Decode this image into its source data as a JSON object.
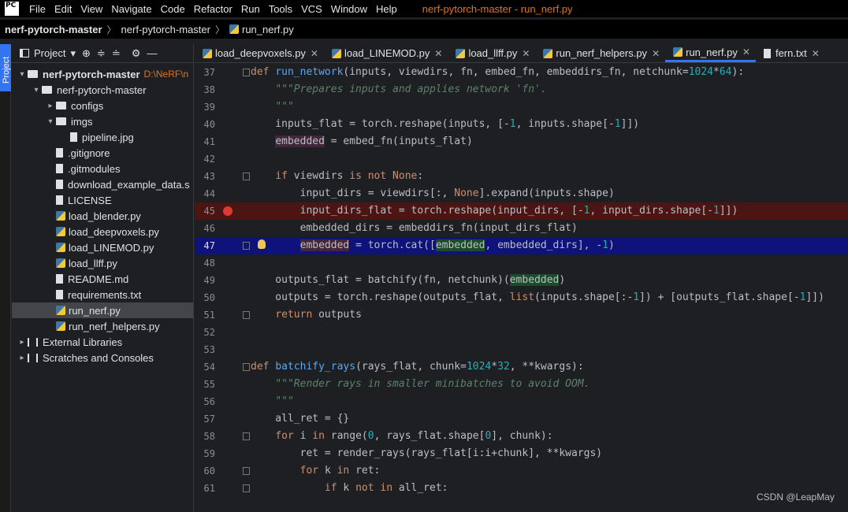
{
  "menubar": {
    "items": [
      "File",
      "Edit",
      "View",
      "Navigate",
      "Code",
      "Refactor",
      "Run",
      "Tools",
      "VCS",
      "Window",
      "Help"
    ],
    "title": "nerf-pytorch-master - run_nerf.py"
  },
  "breadcrumb": {
    "project": "nerf-pytorch-master",
    "folder": "nerf-pytorch-master",
    "file": "run_nerf.py"
  },
  "stripe": {
    "label": "Project"
  },
  "project_panel": {
    "title": "Project",
    "root": "nerf-pytorch-master",
    "root_path": "D:\\NeRF\\n",
    "tree": [
      {
        "label": "nerf-pytorch-master",
        "indent": 1,
        "kind": "folder",
        "arrow": "▾"
      },
      {
        "label": "configs",
        "indent": 2,
        "kind": "folder",
        "arrow": "▸"
      },
      {
        "label": "imgs",
        "indent": 2,
        "kind": "folder",
        "arrow": "▾"
      },
      {
        "label": "pipeline.jpg",
        "indent": 3,
        "kind": "file",
        "arrow": ""
      },
      {
        "label": ".gitignore",
        "indent": 2,
        "kind": "file",
        "arrow": ""
      },
      {
        "label": ".gitmodules",
        "indent": 2,
        "kind": "file",
        "arrow": ""
      },
      {
        "label": "download_example_data.s",
        "indent": 2,
        "kind": "file",
        "arrow": ""
      },
      {
        "label": "LICENSE",
        "indent": 2,
        "kind": "file",
        "arrow": ""
      },
      {
        "label": "load_blender.py",
        "indent": 2,
        "kind": "file",
        "arrow": ""
      },
      {
        "label": "load_deepvoxels.py",
        "indent": 2,
        "kind": "file",
        "arrow": ""
      },
      {
        "label": "load_LINEMOD.py",
        "indent": 2,
        "kind": "file",
        "arrow": ""
      },
      {
        "label": "load_llff.py",
        "indent": 2,
        "kind": "file",
        "arrow": ""
      },
      {
        "label": "README.md",
        "indent": 2,
        "kind": "file",
        "arrow": ""
      },
      {
        "label": "requirements.txt",
        "indent": 2,
        "kind": "file",
        "arrow": ""
      },
      {
        "label": "run_nerf.py",
        "indent": 2,
        "kind": "file",
        "arrow": "",
        "selected": true
      },
      {
        "label": "run_nerf_helpers.py",
        "indent": 2,
        "kind": "file",
        "arrow": ""
      },
      {
        "label": "External Libraries",
        "indent": 0,
        "kind": "lib",
        "arrow": "▸"
      },
      {
        "label": "Scratches and Consoles",
        "indent": 0,
        "kind": "lib",
        "arrow": "▸"
      }
    ]
  },
  "tabs": [
    {
      "label": "load_deepvoxels.py"
    },
    {
      "label": "load_LINEMOD.py"
    },
    {
      "label": "load_llff.py"
    },
    {
      "label": "run_nerf_helpers.py"
    },
    {
      "label": "run_nerf.py",
      "active": true
    },
    {
      "label": "fern.txt"
    }
  ],
  "editor": {
    "lines": [
      {
        "n": "37",
        "html": "<span class='kw'>def </span><span class='fn'>run_network</span>(inputs, viewdirs, fn, embed_fn, embeddirs_fn, netchunk=<span class='num'>1024</span>*<span class='num'>64</span>):",
        "fold": true
      },
      {
        "n": "38",
        "html": "    <span class='doc'>\"\"\"Prepares inputs and applies network 'fn'.</span>"
      },
      {
        "n": "39",
        "html": "    <span class='doc'>\"\"\"</span>"
      },
      {
        "n": "40",
        "html": "    inputs_flat = torch.reshape(inputs, [-<span class='num'>1</span>, inputs.shape[-<span class='num'>1</span>]])"
      },
      {
        "n": "41",
        "html": "    <span class='hl-purple'>embedded</span> = embed_fn(inputs_flat)"
      },
      {
        "n": "42",
        "html": ""
      },
      {
        "n": "43",
        "html": "    <span class='kw'>if </span>viewdirs <span class='kw'>is not None</span>:",
        "fold": true
      },
      {
        "n": "44",
        "html": "        input_dirs = viewdirs[:, <span class='kw'>None</span>].expand(inputs.shape)"
      },
      {
        "n": "45",
        "html": "        input_dirs_flat = torch.reshape(input_dirs, [-<span class='num'>1</span>, input_dirs.shape[-<span class='num'>1</span>]])",
        "bp": true
      },
      {
        "n": "46",
        "html": "        embedded_dirs = embeddirs_fn(input_dirs_flat)"
      },
      {
        "n": "47",
        "html": "        <span class='hl-purple'>embedded</span> = torch.cat([<span class='hl-green'>embedded</span>, embedded_dirs], -<span class='num'>1</span>)",
        "cur": true,
        "fold": true
      },
      {
        "n": "48",
        "html": ""
      },
      {
        "n": "49",
        "html": "    outputs_flat = batchify(fn, netchunk)(<span class='hl-green'>embedded</span>)"
      },
      {
        "n": "50",
        "html": "    outputs = torch.reshape(outputs_flat, <span class='kw'>list</span>(inputs.shape[:-<span class='num'>1</span>]) + [outputs_flat.shape[-<span class='num'>1</span>]])"
      },
      {
        "n": "51",
        "html": "    <span class='kw'>return </span>outputs",
        "fold": true
      },
      {
        "n": "52",
        "html": ""
      },
      {
        "n": "53",
        "html": ""
      },
      {
        "n": "54",
        "html": "<span class='kw'>def </span><span class='fn'>batchify_rays</span>(rays_flat, chunk=<span class='num'>1024</span>*<span class='num'>32</span>, **kwargs):",
        "fold": true
      },
      {
        "n": "55",
        "html": "    <span class='doc'>\"\"\"Render rays in smaller minibatches to avoid OOM.</span>"
      },
      {
        "n": "56",
        "html": "    <span class='doc'>\"\"\"</span>"
      },
      {
        "n": "57",
        "html": "    all_ret = {}"
      },
      {
        "n": "58",
        "html": "    <span class='kw'>for </span>i <span class='kw'>in </span>range(<span class='num'>0</span>, rays_flat.shape[<span class='num'>0</span>], chunk):",
        "fold": true
      },
      {
        "n": "59",
        "html": "        ret = render_rays(rays_flat[i:i+chunk], **kwargs)"
      },
      {
        "n": "60",
        "html": "        <span class='kw'>for </span>k <span class='kw'>in </span>ret:",
        "fold": true
      },
      {
        "n": "61",
        "html": "            <span class='kw'>if </span>k <span class='kw'>not in </span>all_ret:",
        "fold": true
      }
    ]
  },
  "watermark": "CSDN @LeapMay",
  "colors": {
    "accent": "#3574f0",
    "breakpoint_line": "#4a1513",
    "current_line": "#0f127a",
    "title": "#e0731b"
  }
}
